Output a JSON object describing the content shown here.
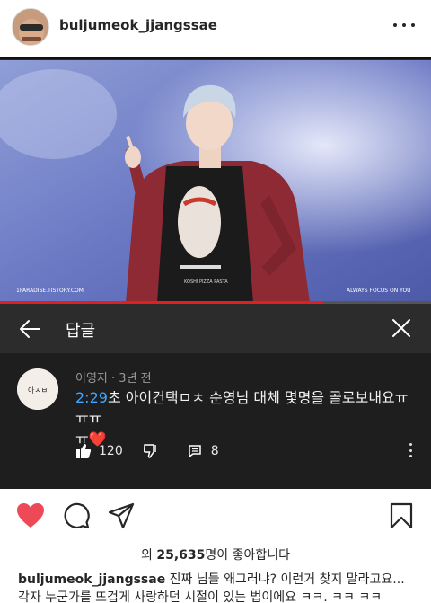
{
  "post": {
    "username": "buljumeok_jjangssae",
    "more_label": "more options"
  },
  "video": {
    "watermark_left": "1PARADISE.TISTORY.COM",
    "watermark_right": "ALWAYS FOCUS ON YOU",
    "shirt_text": "KOSHI PIZZA PASTA",
    "progress_fraction": 0.75
  },
  "reply_bar": {
    "title": "답글"
  },
  "comment": {
    "author": "이영지",
    "age": "3년 전",
    "separator": " · ",
    "timestamp": "2:29",
    "text_line1": "초 아이컨택ㅁㅊ 순영님 대체 몇명을 골로보내요ㅠㅠㅠ",
    "text_line2": "ㅠ",
    "heart": "❤️",
    "like_count": "120",
    "reply_count": "8",
    "avatar_text": "아ㅅㅂ"
  },
  "engagement": {
    "likes_prefix": "외 ",
    "likes_count": "25,635",
    "likes_suffix": "명이 좋아합니다"
  },
  "caption": {
    "username": "buljumeok_jjangssae",
    "line1": " 진짜 님들 왜그러냐? 이런거 찾지 말라고요...",
    "line2": "각자 누군가를 뜨겁게 사랑하던 시절이 있는 법이에요 ㅋㅋ. ㅋㅋ ㅋㅋ"
  },
  "colors": {
    "heart_red": "#ed4956",
    "timestamp_blue": "#3ea6ff",
    "progress_red": "#e02020"
  }
}
